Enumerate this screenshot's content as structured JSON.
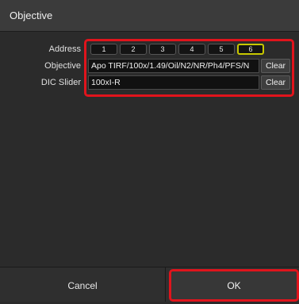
{
  "window": {
    "title": "Objective"
  },
  "address": {
    "label": "Address",
    "buttons": [
      "1",
      "2",
      "3",
      "4",
      "5",
      "6"
    ],
    "selected": "6"
  },
  "objective": {
    "label": "Objective",
    "value": "Apo TIRF/100x/1.49/Oil/N2/NR/Ph4/PFS/N",
    "clear_label": "Clear"
  },
  "dic_slider": {
    "label": "DIC Slider",
    "value": "100xI-R",
    "clear_label": "Clear"
  },
  "footer": {
    "cancel_label": "Cancel",
    "ok_label": "OK"
  },
  "colors": {
    "background": "#2b2b2b",
    "highlight": "#e0141c",
    "selected_border": "#c8c800"
  }
}
